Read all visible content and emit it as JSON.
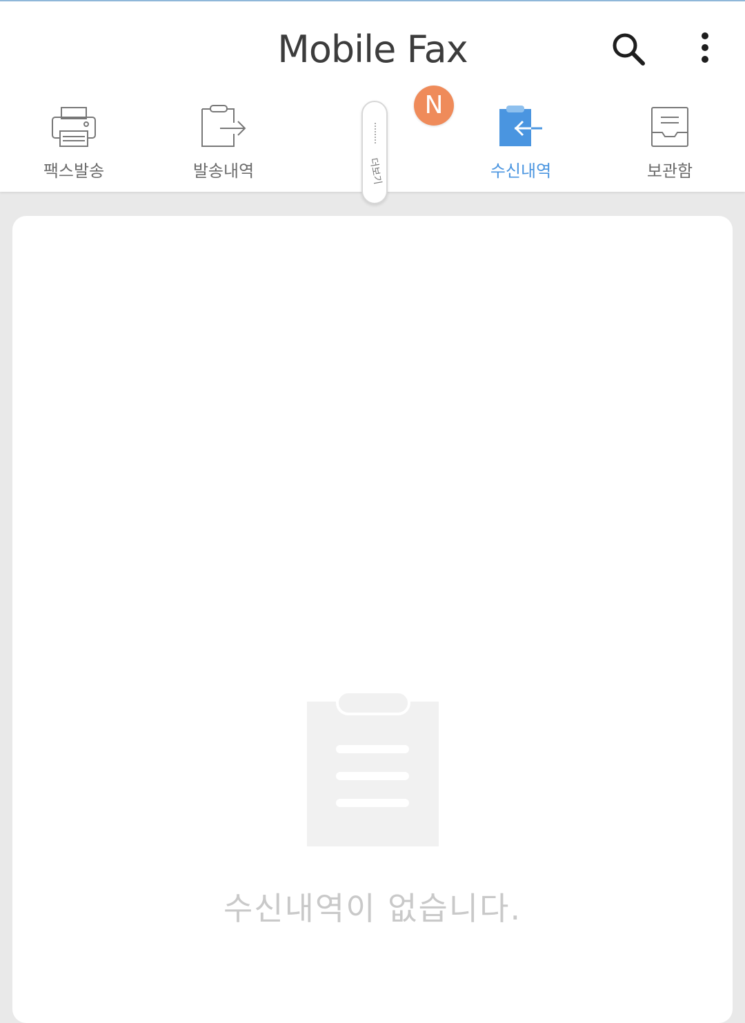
{
  "app": {
    "title": "Mobile Fax"
  },
  "header": {
    "search_icon": "search-icon",
    "more_icon": "more-vert-icon"
  },
  "tabs": [
    {
      "label": "팩스발송",
      "icon": "printer-icon",
      "active": false
    },
    {
      "label": "발송내역",
      "icon": "clipboard-send-icon",
      "active": false
    },
    {
      "label": "수신내역",
      "icon": "clipboard-receive-icon",
      "active": true
    },
    {
      "label": "보관함",
      "icon": "archive-tray-icon",
      "active": false
    }
  ],
  "badge": {
    "text": "N"
  },
  "side_handle": {
    "label": "더보기"
  },
  "empty_state": {
    "icon": "clipboard-list-icon",
    "message": "수신내역이 없습니다."
  },
  "colors": {
    "accent": "#4a95e0",
    "badge": "#ef8b5a",
    "background": "#e9e9e9"
  }
}
